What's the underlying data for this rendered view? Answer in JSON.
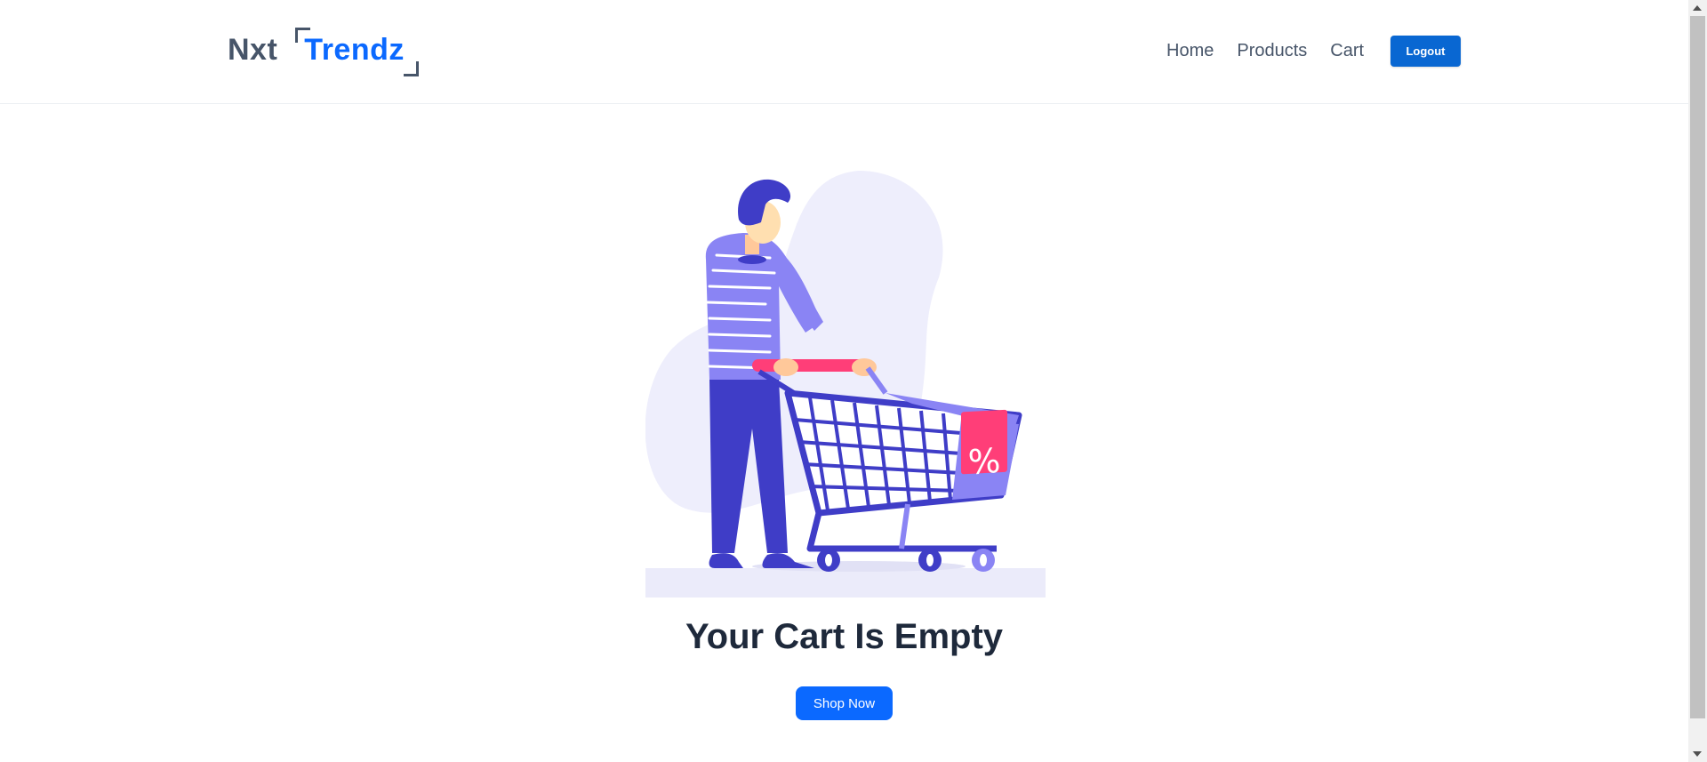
{
  "header": {
    "logo": {
      "part1": "Nxt",
      "part2": "Trendz"
    },
    "nav": [
      {
        "label": "Home"
      },
      {
        "label": "Products"
      },
      {
        "label": "Cart"
      }
    ],
    "logout_label": "Logout"
  },
  "main": {
    "title": "Your Cart Is Empty",
    "shop_now_label": "Shop Now",
    "illustration": {
      "icon": "empty-cart-illustration",
      "badge_text": "%"
    }
  },
  "colors": {
    "brand_blue": "#0b69ff",
    "logout_blue": "#0967d2",
    "text_dark": "#1e293b",
    "nav_gray": "#475569",
    "illustration_indigo": "#3f3dc7",
    "illustration_periwinkle": "#8a84f4",
    "illustration_pink": "#ff3e78"
  }
}
